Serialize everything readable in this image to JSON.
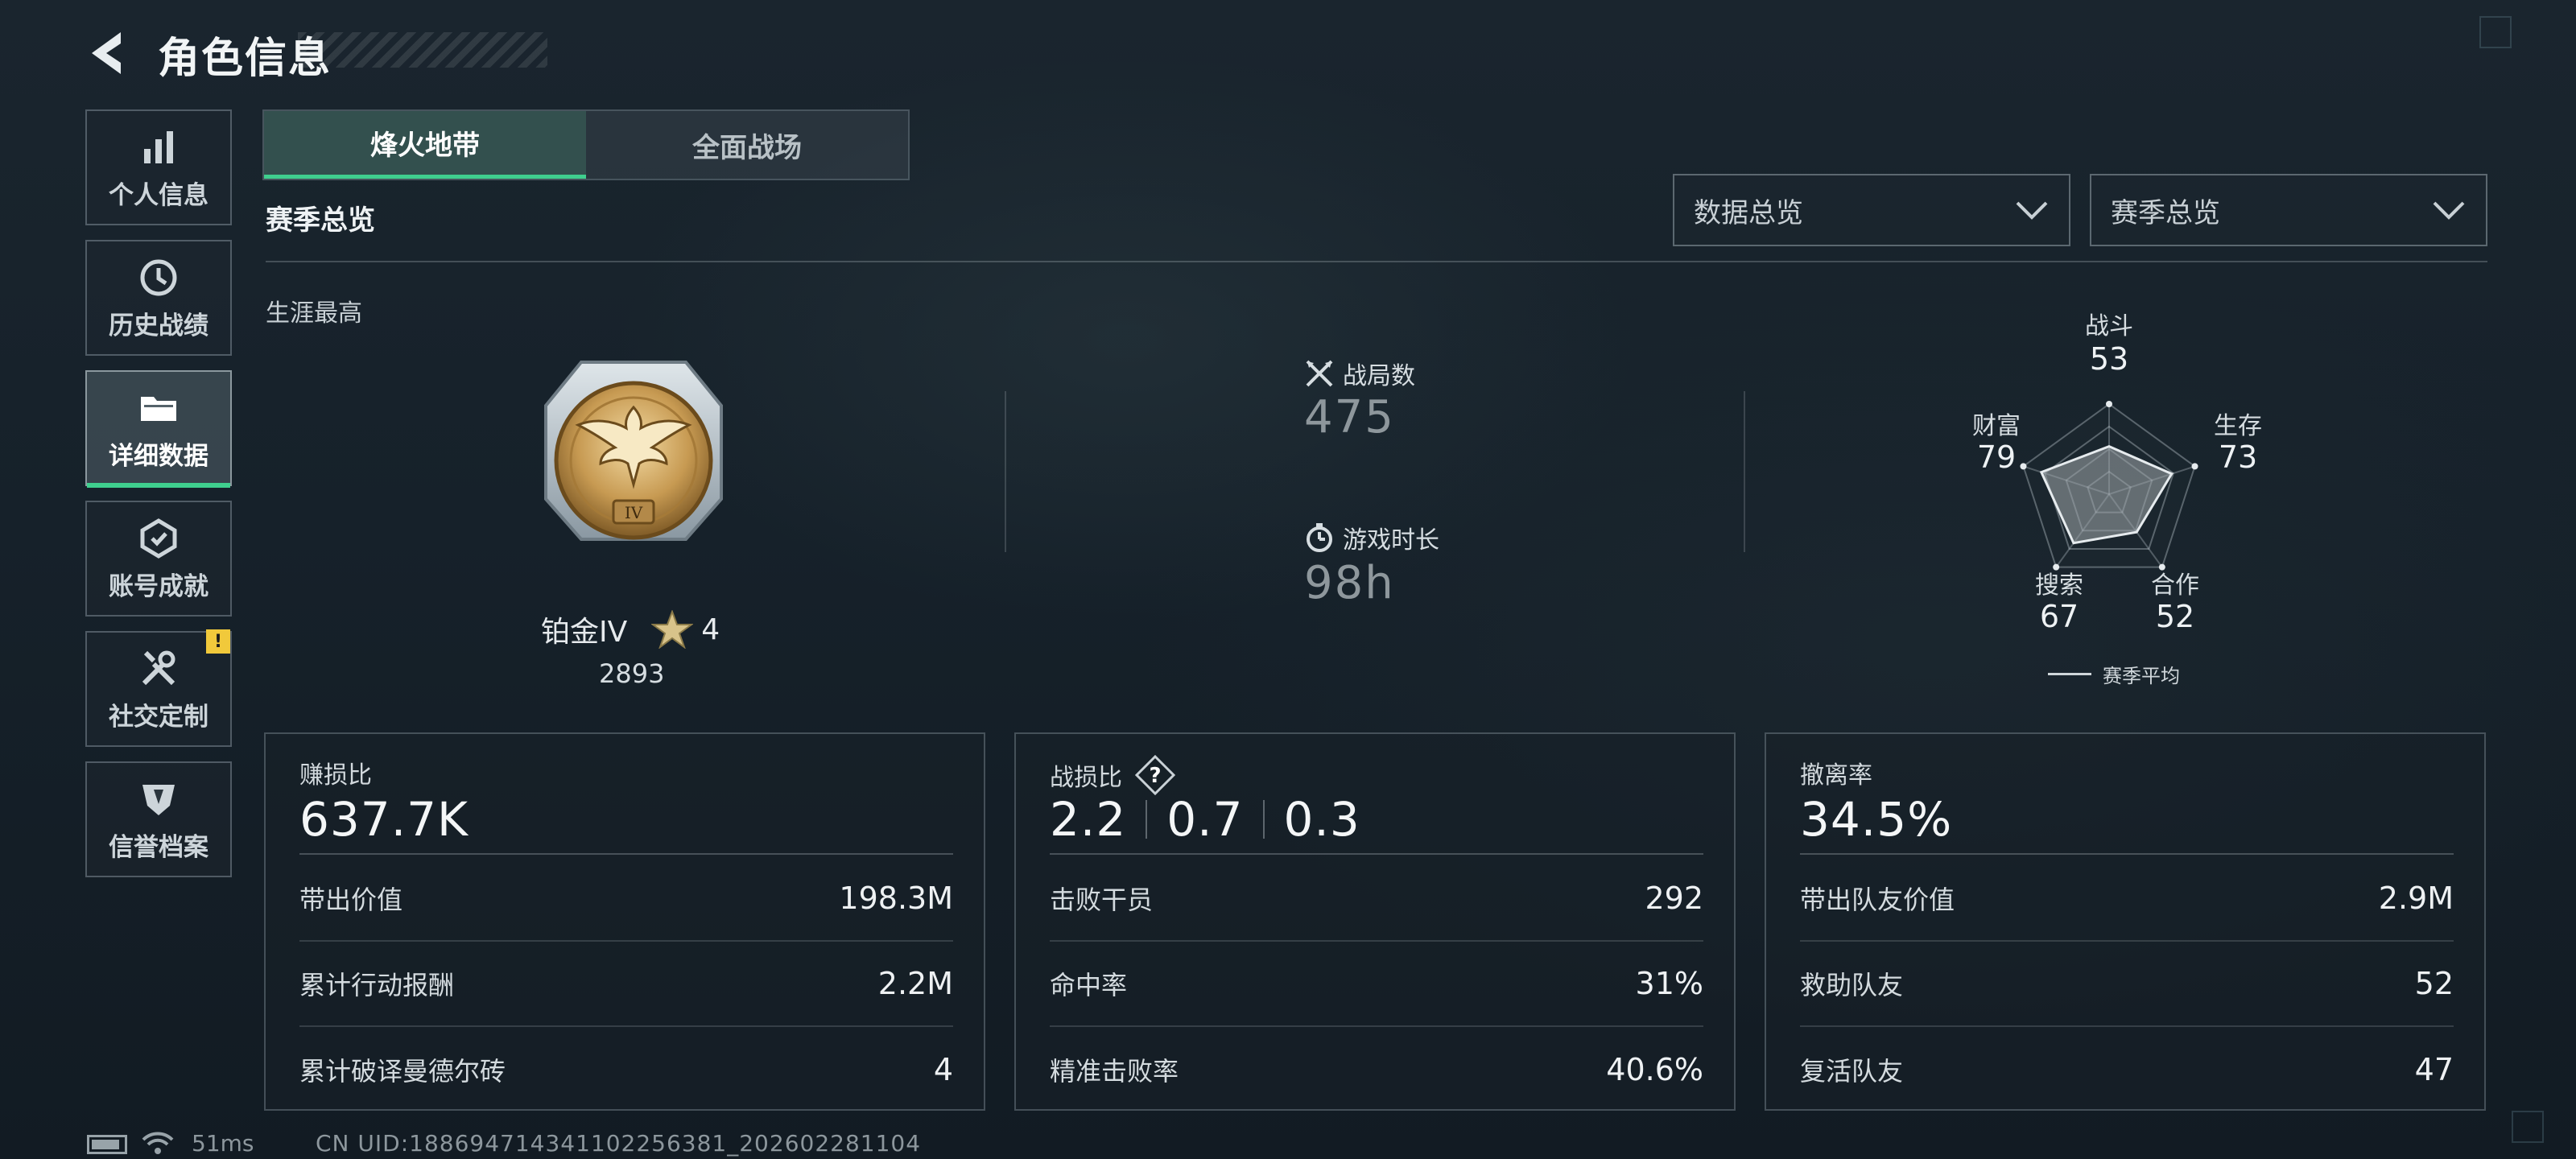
{
  "header": {
    "title": "角色信息"
  },
  "sidebar": {
    "items": [
      {
        "label": "个人信息",
        "icon": "bar-chart-icon"
      },
      {
        "label": "历史战绩",
        "icon": "clock-icon"
      },
      {
        "label": "详细数据",
        "icon": "folder-icon",
        "active": true
      },
      {
        "label": "账号成就",
        "icon": "achievement-icon"
      },
      {
        "label": "社交定制",
        "icon": "tools-icon",
        "alert": "!"
      },
      {
        "label": "信誉档案",
        "icon": "shield-emblem-icon"
      }
    ]
  },
  "tabs": [
    {
      "label": "烽火地带",
      "active": true
    },
    {
      "label": "全面战场",
      "active": false
    }
  ],
  "section": {
    "title": "赛季总览",
    "career_label": "生涯最高"
  },
  "dropdowns": [
    {
      "value": "数据总览"
    },
    {
      "value": "赛季总览"
    }
  ],
  "rank": {
    "name": "铂金IV",
    "stars": "4",
    "score": "2893"
  },
  "mid_stats": [
    {
      "label": "战局数",
      "value": "475",
      "icon": "crossed-swords-icon"
    },
    {
      "label": "游戏时长",
      "value": "98h",
      "icon": "stopwatch-icon"
    }
  ],
  "radar": {
    "axes": [
      {
        "label": "战斗",
        "value": "53",
        "score": 53
      },
      {
        "label": "生存",
        "value": "73",
        "score": 73
      },
      {
        "label": "合作",
        "value": "52",
        "score": 52
      },
      {
        "label": "搜索",
        "value": "67",
        "score": 67
      },
      {
        "label": "财富",
        "value": "79",
        "score": 79
      }
    ],
    "legend": "赛季平均"
  },
  "panels": [
    {
      "title": "赚损比",
      "big": "637.7K",
      "rows": [
        {
          "label": "带出价值",
          "value": "198.3M"
        },
        {
          "label": "累计行动报酬",
          "value": "2.2M"
        },
        {
          "label": "累计破译曼德尔砖",
          "value": "4"
        }
      ]
    },
    {
      "title": "战损比",
      "big_parts": [
        "2.2",
        "0.7",
        "0.3"
      ],
      "help": "?",
      "rows": [
        {
          "label": "击败干员",
          "value": "292"
        },
        {
          "label": "命中率",
          "value": "31%"
        },
        {
          "label": "精准击败率",
          "value": "40.6%"
        }
      ]
    },
    {
      "title": "撤离率",
      "big": "34.5%",
      "rows": [
        {
          "label": "带出队友价值",
          "value": "2.9M"
        },
        {
          "label": "救助队友",
          "value": "52"
        },
        {
          "label": "复活队友",
          "value": "47"
        }
      ]
    }
  ],
  "footer": {
    "ping": "51ms",
    "uid": "CN UID:18869471434110225638​1_202602281104"
  },
  "colors": {
    "accent": "#3fcf8e",
    "alert": "#f1c93b"
  }
}
